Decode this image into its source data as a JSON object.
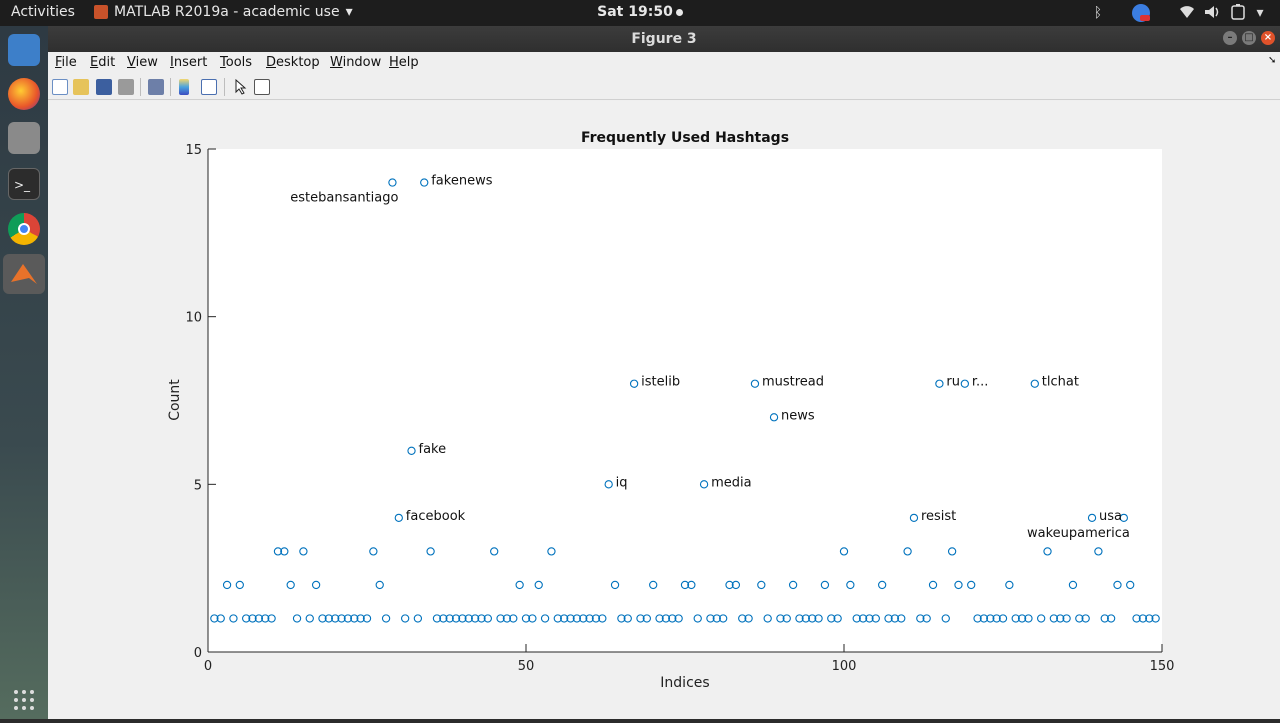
{
  "system": {
    "activities": "Activities",
    "app_menu": "MATLAB R2019a - academic use",
    "clock": "Sat 19:50",
    "tray_icons": [
      "bluetooth-icon",
      "chrome-badge-icon",
      "wifi-icon",
      "volume-icon",
      "battery-icon",
      "power-menu-icon"
    ]
  },
  "dock": {
    "icons": [
      "thunderbird-icon",
      "firefox-icon",
      "files-icon",
      "terminal-icon",
      "chrome-icon",
      "matlab-icon",
      "app-grid-icon"
    ]
  },
  "window": {
    "title": "Figure 3",
    "menus": [
      {
        "label": "File",
        "key": "F",
        "rest": "ile"
      },
      {
        "label": "Edit",
        "key": "E",
        "rest": "dit"
      },
      {
        "label": "View",
        "key": "V",
        "rest": "iew"
      },
      {
        "label": "Insert",
        "key": "I",
        "rest": "nsert"
      },
      {
        "label": "Tools",
        "key": "T",
        "rest": "ools"
      },
      {
        "label": "Desktop",
        "key": "D",
        "rest": "esktop"
      },
      {
        "label": "Window",
        "key": "W",
        "rest": "indow"
      },
      {
        "label": "Help",
        "key": "H",
        "rest": "elp"
      }
    ],
    "toolbar_icons": [
      "new-figure-icon",
      "open-icon",
      "save-icon",
      "print-icon",
      "link-plot-icon",
      "colorbar-icon",
      "legend-icon",
      "pointer-icon",
      "property-editor-icon"
    ]
  },
  "chart_data": {
    "type": "scatter",
    "title": "Frequently Used Hashtags",
    "xlabel": "Indices",
    "ylabel": "Count",
    "xlim": [
      0,
      150
    ],
    "ylim": [
      0,
      15
    ],
    "xticks": [
      0,
      50,
      100,
      150
    ],
    "yticks": [
      0,
      5,
      10,
      15
    ],
    "marker_color": "#0072BD",
    "points": [
      [
        1,
        1
      ],
      [
        2,
        1
      ],
      [
        3,
        2
      ],
      [
        4,
        1
      ],
      [
        5,
        2
      ],
      [
        6,
        1
      ],
      [
        7,
        1
      ],
      [
        8,
        1
      ],
      [
        9,
        1
      ],
      [
        10,
        1
      ],
      [
        11,
        3
      ],
      [
        12,
        3
      ],
      [
        13,
        2
      ],
      [
        14,
        1
      ],
      [
        15,
        3
      ],
      [
        16,
        1
      ],
      [
        17,
        2
      ],
      [
        18,
        1
      ],
      [
        19,
        1
      ],
      [
        20,
        1
      ],
      [
        21,
        1
      ],
      [
        22,
        1
      ],
      [
        23,
        1
      ],
      [
        24,
        1
      ],
      [
        25,
        1
      ],
      [
        26,
        3
      ],
      [
        27,
        2
      ],
      [
        28,
        1
      ],
      [
        29,
        14
      ],
      [
        30,
        4
      ],
      [
        31,
        1
      ],
      [
        32,
        6
      ],
      [
        33,
        1
      ],
      [
        34,
        14
      ],
      [
        35,
        3
      ],
      [
        36,
        1
      ],
      [
        37,
        1
      ],
      [
        38,
        1
      ],
      [
        39,
        1
      ],
      [
        40,
        1
      ],
      [
        41,
        1
      ],
      [
        42,
        1
      ],
      [
        43,
        1
      ],
      [
        44,
        1
      ],
      [
        45,
        3
      ],
      [
        46,
        1
      ],
      [
        47,
        1
      ],
      [
        48,
        1
      ],
      [
        49,
        2
      ],
      [
        50,
        1
      ],
      [
        51,
        1
      ],
      [
        52,
        2
      ],
      [
        53,
        1
      ],
      [
        54,
        3
      ],
      [
        55,
        1
      ],
      [
        56,
        1
      ],
      [
        57,
        1
      ],
      [
        58,
        1
      ],
      [
        59,
        1
      ],
      [
        60,
        1
      ],
      [
        61,
        1
      ],
      [
        62,
        1
      ],
      [
        63,
        5
      ],
      [
        64,
        2
      ],
      [
        65,
        1
      ],
      [
        66,
        1
      ],
      [
        67,
        8
      ],
      [
        68,
        1
      ],
      [
        69,
        1
      ],
      [
        70,
        2
      ],
      [
        71,
        1
      ],
      [
        72,
        1
      ],
      [
        73,
        1
      ],
      [
        74,
        1
      ],
      [
        75,
        2
      ],
      [
        76,
        2
      ],
      [
        77,
        1
      ],
      [
        78,
        5
      ],
      [
        79,
        1
      ],
      [
        80,
        1
      ],
      [
        81,
        1
      ],
      [
        82,
        2
      ],
      [
        83,
        2
      ],
      [
        84,
        1
      ],
      [
        85,
        1
      ],
      [
        86,
        8
      ],
      [
        87,
        2
      ],
      [
        88,
        1
      ],
      [
        89,
        7
      ],
      [
        90,
        1
      ],
      [
        91,
        1
      ],
      [
        92,
        2
      ],
      [
        93,
        1
      ],
      [
        94,
        1
      ],
      [
        95,
        1
      ],
      [
        96,
        1
      ],
      [
        97,
        2
      ],
      [
        98,
        1
      ],
      [
        99,
        1
      ],
      [
        100,
        3
      ],
      [
        101,
        2
      ],
      [
        102,
        1
      ],
      [
        103,
        1
      ],
      [
        104,
        1
      ],
      [
        105,
        1
      ],
      [
        106,
        2
      ],
      [
        107,
        1
      ],
      [
        108,
        1
      ],
      [
        109,
        1
      ],
      [
        110,
        3
      ],
      [
        111,
        4
      ],
      [
        112,
        1
      ],
      [
        113,
        1
      ],
      [
        114,
        2
      ],
      [
        115,
        8
      ],
      [
        116,
        1
      ],
      [
        117,
        3
      ],
      [
        118,
        2
      ],
      [
        119,
        8
      ],
      [
        120,
        2
      ],
      [
        121,
        1
      ],
      [
        122,
        1
      ],
      [
        123,
        1
      ],
      [
        124,
        1
      ],
      [
        125,
        1
      ],
      [
        126,
        2
      ],
      [
        127,
        1
      ],
      [
        128,
        1
      ],
      [
        129,
        1
      ],
      [
        130,
        8
      ],
      [
        131,
        1
      ],
      [
        132,
        3
      ],
      [
        133,
        1
      ],
      [
        134,
        1
      ],
      [
        135,
        1
      ],
      [
        136,
        2
      ],
      [
        137,
        1
      ],
      [
        138,
        1
      ],
      [
        139,
        4
      ],
      [
        140,
        3
      ],
      [
        141,
        1
      ],
      [
        142,
        1
      ],
      [
        143,
        2
      ],
      [
        144,
        4
      ],
      [
        145,
        2
      ],
      [
        146,
        1
      ],
      [
        147,
        1
      ],
      [
        148,
        1
      ],
      [
        149,
        1
      ]
    ],
    "annotations": [
      {
        "x": 34,
        "y": 14,
        "text": "fakenews",
        "pos": "right"
      },
      {
        "x": 29,
        "y": 14,
        "text": "estebansantiago",
        "pos": "below-left"
      },
      {
        "x": 67,
        "y": 8,
        "text": "istelib",
        "pos": "right"
      },
      {
        "x": 86,
        "y": 8,
        "text": "mustread",
        "pos": "right"
      },
      {
        "x": 89,
        "y": 7,
        "text": "news",
        "pos": "right"
      },
      {
        "x": 115,
        "y": 8,
        "text": "ru",
        "pos": "right"
      },
      {
        "x": 119,
        "y": 8,
        "text": "r...",
        "pos": "right"
      },
      {
        "x": 130,
        "y": 8,
        "text": "tlchat",
        "pos": "right"
      },
      {
        "x": 32,
        "y": 6,
        "text": "fake",
        "pos": "right"
      },
      {
        "x": 63,
        "y": 5,
        "text": "iq",
        "pos": "right"
      },
      {
        "x": 78,
        "y": 5,
        "text": "media",
        "pos": "right"
      },
      {
        "x": 30,
        "y": 4,
        "text": "facebook",
        "pos": "right"
      },
      {
        "x": 111,
        "y": 4,
        "text": "resist",
        "pos": "right"
      },
      {
        "x": 139,
        "y": 4,
        "text": "usa",
        "pos": "right"
      },
      {
        "x": 144,
        "y": 4,
        "text": "wakeupamerica",
        "pos": "below-left"
      }
    ]
  }
}
